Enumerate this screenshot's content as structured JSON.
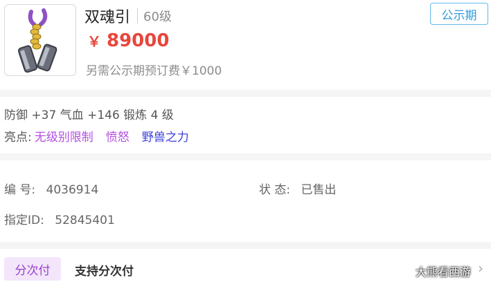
{
  "item": {
    "name": "双魂引",
    "level": "60级",
    "currency": "￥",
    "price": "89000",
    "fee_text": "另需公示期预订费￥1000",
    "status_tag": "公示期"
  },
  "attributes": {
    "line": "防御 +37  气血 +146  锻炼 4 级",
    "highlight_label": "亮点:",
    "highlights": [
      {
        "text": "无级别限制",
        "color": "#b44fe0"
      },
      {
        "text": "愤怒",
        "color": "#b44fe0"
      },
      {
        "text": "野兽之力",
        "color": "#3b42d8"
      }
    ]
  },
  "info": {
    "serial_label": "编 号:",
    "serial_value": "4036914",
    "status_label": "状 态:",
    "status_value": "已售出",
    "id_label": "指定ID:",
    "id_value": "52845401"
  },
  "installment": {
    "tag": "分次付",
    "text": "支持分次付"
  },
  "watermark": "大熊看西游",
  "colors": {
    "price": "#e8453c",
    "public_tag": "#2f9bd8",
    "installment_bg": "#f3e6fb"
  },
  "icons": {
    "item_image": "weapon-item-icon",
    "arrow": "chevron-right-icon"
  }
}
